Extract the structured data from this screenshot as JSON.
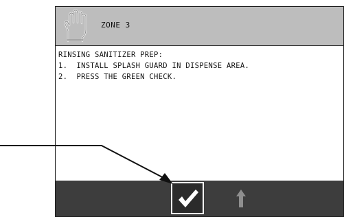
{
  "header": {
    "zone_title": "ZONE 3"
  },
  "instructions": {
    "line1": "RINSING SANITIZER PREP:",
    "line2": "1.  INSTALL SPLASH GUARD IN DISPENSE AREA.",
    "line3": "2.  PRESS THE GREEN CHECK."
  },
  "footer": {
    "buttons": [
      {
        "name": "confirm",
        "icon": "checkmark-icon"
      },
      {
        "name": "back",
        "icon": "up-arrow-icon"
      }
    ]
  },
  "colors": {
    "header_bg": "#bdbdbd",
    "footer_bg": "#3d3d3d",
    "screen_bg": "#ffffff"
  }
}
